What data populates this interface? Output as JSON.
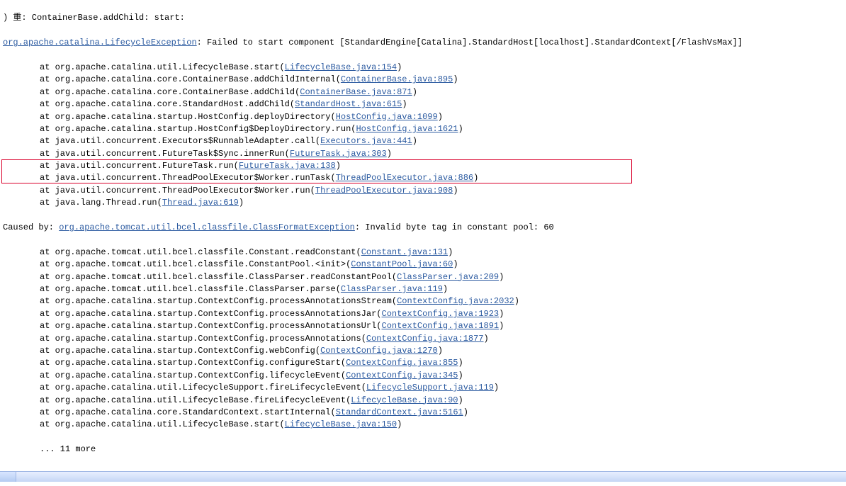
{
  "header_line": ") 重: ContainerBase.addChild: start:",
  "exception_prefix_link": "org.apache.catalina.LifecycleException",
  "exception_message": ": Failed to start component [StandardEngine[Catalina].StandardHost[localhost].StandardContext[/FlashVsMax]]",
  "at": "at ",
  "caused_by_prefix": "Caused by: ",
  "caused_by_link": "org.apache.tomcat.util.bcel.classfile.ClassFormatException",
  "caused_by_msg": ": Invalid byte tag in constant pool: 60",
  "more_line": "... 11 more",
  "frames": [
    {
      "cls": "org.apache.catalina.util.LifecycleBase.start",
      "file": "LifecycleBase.java:154"
    },
    {
      "cls": "org.apache.catalina.core.ContainerBase.addChildInternal",
      "file": "ContainerBase.java:895"
    },
    {
      "cls": "org.apache.catalina.core.ContainerBase.addChild",
      "file": "ContainerBase.java:871"
    },
    {
      "cls": "org.apache.catalina.core.StandardHost.addChild",
      "file": "StandardHost.java:615"
    },
    {
      "cls": "org.apache.catalina.startup.HostConfig.deployDirectory",
      "file": "HostConfig.java:1099"
    },
    {
      "cls": "org.apache.catalina.startup.HostConfig$DeployDirectory.run",
      "file": "HostConfig.java:1621"
    },
    {
      "cls": "java.util.concurrent.Executors$RunnableAdapter.call",
      "file": "Executors.java:441"
    },
    {
      "cls": "java.util.concurrent.FutureTask$Sync.innerRun",
      "file": "FutureTask.java:303"
    },
    {
      "cls": "java.util.concurrent.FutureTask.run",
      "file": "FutureTask.java:138"
    },
    {
      "cls": "java.util.concurrent.ThreadPoolExecutor$Worker.runTask",
      "file": "ThreadPoolExecutor.java:886"
    },
    {
      "cls": "java.util.concurrent.ThreadPoolExecutor$Worker.run",
      "file": "ThreadPoolExecutor.java:908"
    },
    {
      "cls": "java.lang.Thread.run",
      "file": "Thread.java:619"
    }
  ],
  "caused_frames": [
    {
      "cls": "org.apache.tomcat.util.bcel.classfile.Constant.readConstant",
      "file": "Constant.java:131"
    },
    {
      "cls": "org.apache.tomcat.util.bcel.classfile.ConstantPool.<init>",
      "file": "ConstantPool.java:60"
    },
    {
      "cls": "org.apache.tomcat.util.bcel.classfile.ClassParser.readConstantPool",
      "file": "ClassParser.java:209"
    },
    {
      "cls": "org.apache.tomcat.util.bcel.classfile.ClassParser.parse",
      "file": "ClassParser.java:119"
    },
    {
      "cls": "org.apache.catalina.startup.ContextConfig.processAnnotationsStream",
      "file": "ContextConfig.java:2032"
    },
    {
      "cls": "org.apache.catalina.startup.ContextConfig.processAnnotationsJar",
      "file": "ContextConfig.java:1923"
    },
    {
      "cls": "org.apache.catalina.startup.ContextConfig.processAnnotationsUrl",
      "file": "ContextConfig.java:1891"
    },
    {
      "cls": "org.apache.catalina.startup.ContextConfig.processAnnotations",
      "file": "ContextConfig.java:1877"
    },
    {
      "cls": "org.apache.catalina.startup.ContextConfig.webConfig",
      "file": "ContextConfig.java:1270"
    },
    {
      "cls": "org.apache.catalina.startup.ContextConfig.configureStart",
      "file": "ContextConfig.java:855"
    },
    {
      "cls": "org.apache.catalina.startup.ContextConfig.lifecycleEvent",
      "file": "ContextConfig.java:345"
    },
    {
      "cls": "org.apache.catalina.util.LifecycleSupport.fireLifecycleEvent",
      "file": "LifecycleSupport.java:119"
    },
    {
      "cls": "org.apache.catalina.util.LifecycleBase.fireLifecycleEvent",
      "file": "LifecycleBase.java:90"
    },
    {
      "cls": "org.apache.catalina.core.StandardContext.startInternal",
      "file": "StandardContext.java:5161"
    },
    {
      "cls": "org.apache.catalina.util.LifecycleBase.start",
      "file": "LifecycleBase.java:150"
    }
  ]
}
